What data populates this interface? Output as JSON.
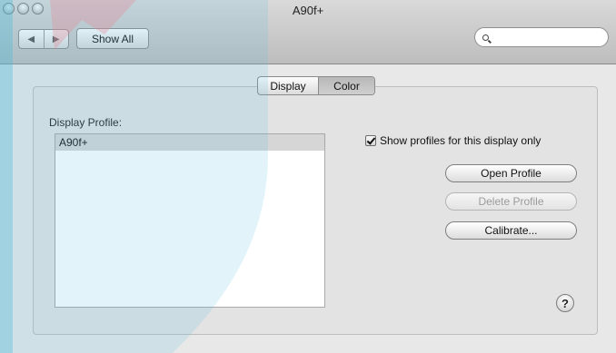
{
  "window": {
    "title": "A90f+"
  },
  "toolbar": {
    "nav_back_icon": "chevron-left",
    "nav_forward_icon": "chevron-right",
    "show_all_label": "Show All",
    "search_placeholder": "",
    "search_value": ""
  },
  "tabs": [
    {
      "label": "Display",
      "selected": false
    },
    {
      "label": "Color",
      "selected": true
    }
  ],
  "profile": {
    "label": "Display Profile:",
    "items": [
      "A90f+"
    ],
    "selected_index": 0
  },
  "options": {
    "show_profiles_label": "Show profiles for this display only",
    "show_profiles_checked": true
  },
  "buttons": {
    "open_label": "Open Profile",
    "delete_label": "Delete Profile",
    "calibrate_label": "Calibrate..."
  },
  "help": {
    "label": "?"
  },
  "colors": {
    "overlay_cyan": "#5cc4e0",
    "overlay_red": "#e58a9a"
  }
}
